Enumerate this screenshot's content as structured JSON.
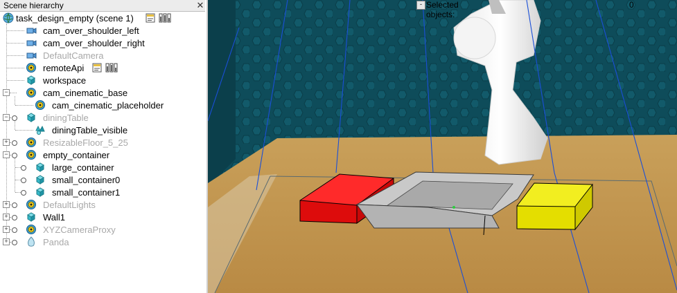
{
  "panel": {
    "title": "Scene hierarchy",
    "close_glyph": "✕"
  },
  "tree": [
    {
      "label": "task_design_empty (scene 1)",
      "icon": "world-icon",
      "dim": false,
      "extras": [
        "script-icon",
        "param-icon"
      ]
    },
    {
      "label": "cam_over_shoulder_left",
      "icon": "camera-icon",
      "dim": false
    },
    {
      "label": "cam_over_shoulder_right",
      "icon": "camera-icon",
      "dim": false
    },
    {
      "label": "DefaultCamera",
      "icon": "camera-icon",
      "dim": true
    },
    {
      "label": "remoteApi",
      "icon": "dummy-icon",
      "dim": false,
      "extras": [
        "script-icon",
        "param-icon"
      ]
    },
    {
      "label": "workspace",
      "icon": "shape-icon",
      "dim": false
    },
    {
      "label": "cam_cinematic_base",
      "icon": "dummy-icon",
      "dim": false
    },
    {
      "label": "cam_cinematic_placeholder",
      "icon": "dummy-icon",
      "dim": false
    },
    {
      "label": "diningTable",
      "icon": "shape-icon",
      "dim": true
    },
    {
      "label": "diningTable_visible",
      "icon": "multishape-icon",
      "dim": false
    },
    {
      "label": "ResizableFloor_5_25",
      "icon": "dummy-icon",
      "dim": true
    },
    {
      "label": "empty_container",
      "icon": "dummy-icon",
      "dim": false
    },
    {
      "label": "large_container",
      "icon": "shape-icon",
      "dim": false
    },
    {
      "label": "small_container0",
      "icon": "shape-icon",
      "dim": false
    },
    {
      "label": "small_container1",
      "icon": "shape-icon",
      "dim": false
    },
    {
      "label": "DefaultLights",
      "icon": "dummy-icon",
      "dim": true
    },
    {
      "label": "Wall1",
      "icon": "shape-icon",
      "dim": false
    },
    {
      "label": "XYZCameraProxy",
      "icon": "dummy-icon",
      "dim": true
    },
    {
      "label": "Panda",
      "icon": "panda-icon",
      "dim": true
    }
  ],
  "viewport": {
    "button_glyph": "-",
    "selected_label": "Selected objects:",
    "selected_value": "0"
  },
  "colors": {
    "wall": "#0e4c5a",
    "floor": "#c49a52",
    "red_box": "#e01010",
    "yellow_box": "#e6e000",
    "tray": "#b8b8b8",
    "lines": "#1a4fd8"
  }
}
